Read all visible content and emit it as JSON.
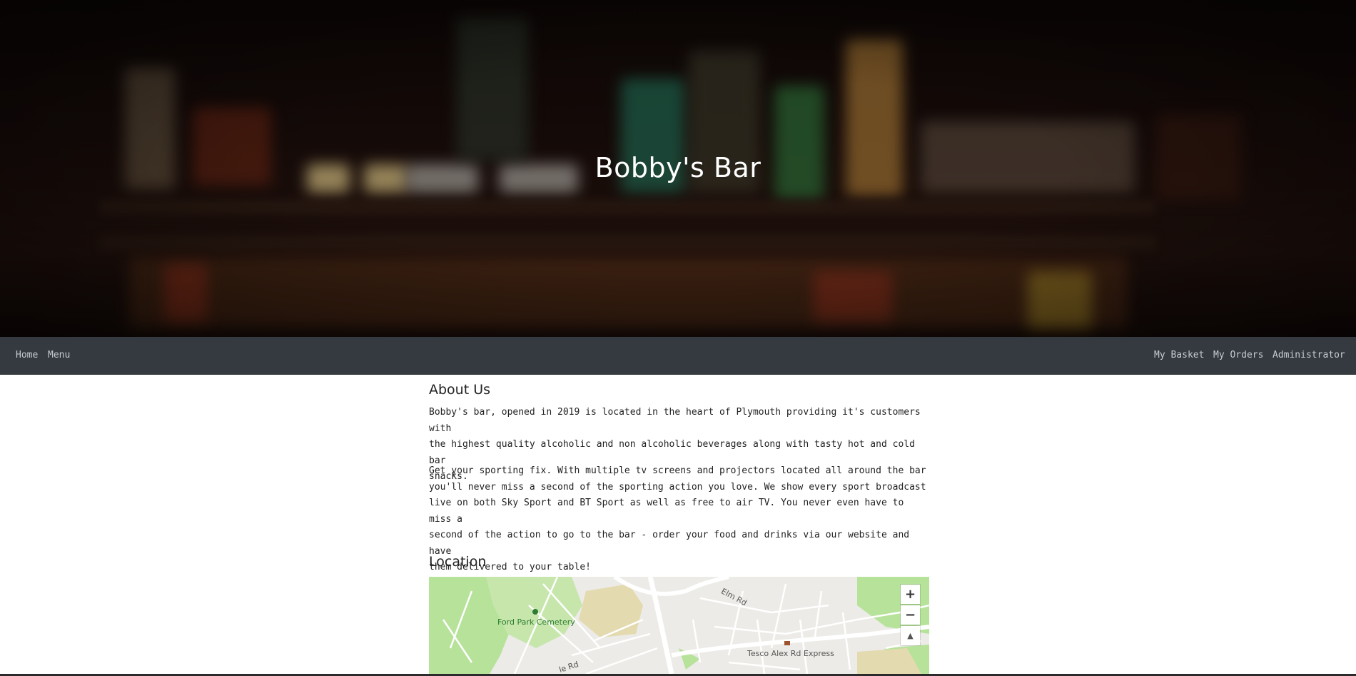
{
  "hero": {
    "title": "Bobby's Bar"
  },
  "nav": {
    "left": [
      {
        "label": "Home"
      },
      {
        "label": "Menu"
      }
    ],
    "right": [
      {
        "label": "My Basket"
      },
      {
        "label": "My Orders"
      },
      {
        "label": "Administrator"
      }
    ]
  },
  "about": {
    "heading": "About Us",
    "paragraph1_lines": [
      "Bobby's bar, opened in 2019 is located in the heart of Plymouth providing it's customers with",
      "the highest quality alcoholic and non alcoholic beverages along with tasty hot and cold bar",
      "snacks."
    ],
    "paragraph2_lines": [
      "Get your sporting fix. With multiple tv screens and projectors located all around the bar",
      "you'll never miss a second of the sporting action you love. We show every sport broadcast",
      "live on both Sky Sport and BT Sport as well as free to air TV. You never even have to miss a",
      "second of the action to go to the bar - order your food and drinks via our website and have",
      "them delivered to your table!"
    ]
  },
  "location": {
    "heading": "Location",
    "map": {
      "labels": {
        "cemetery": "Ford Park Cemetery",
        "elm_rd": "Elm Rd",
        "tesco": "Tesco Alex Rd Express",
        "bottom_road": "le Rd"
      },
      "controls": {
        "zoom_in": "+",
        "zoom_out": "−",
        "compass": "▲"
      },
      "colors": {
        "park": "#b6e29a",
        "land": "#ecebe7",
        "roads": "#ffffff",
        "sand": "#e4dab0"
      }
    }
  }
}
